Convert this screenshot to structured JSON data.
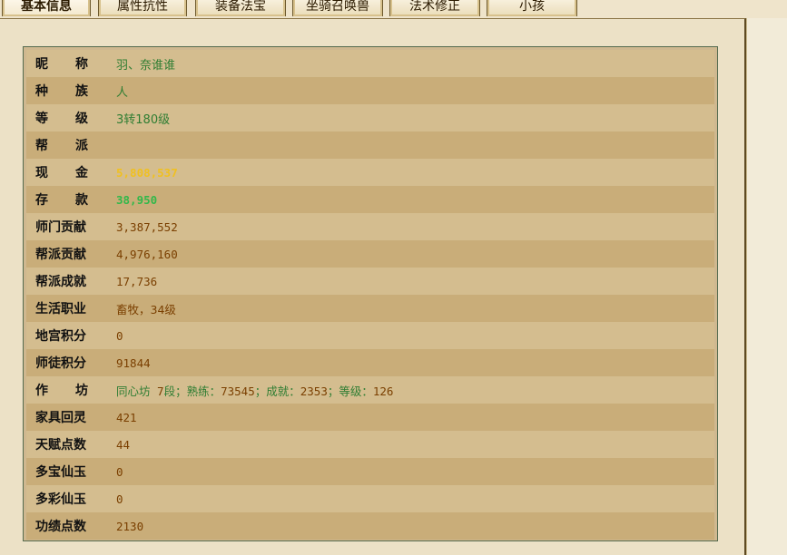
{
  "tabs": [
    {
      "label": "基本信息",
      "active": true
    },
    {
      "label": "属性抗性"
    },
    {
      "label": "装备法宝"
    },
    {
      "label": "坐骑召唤兽"
    },
    {
      "label": "法术修正"
    },
    {
      "label": "小孩"
    }
  ],
  "rows": [
    {
      "label": "昵称",
      "value": "羽、奈谁谁"
    },
    {
      "label": "种族",
      "value": "人"
    },
    {
      "label": "等级",
      "value": "3转180级"
    },
    {
      "label": "帮派",
      "value": ""
    },
    {
      "label": "现金",
      "value": "5,808,537"
    },
    {
      "label": "存款",
      "value": "38,950"
    },
    {
      "label": "师门贡献",
      "value": "3,387,552"
    },
    {
      "label": "帮派贡献",
      "value": "4,976,160"
    },
    {
      "label": "帮派成就",
      "value": "17,736"
    },
    {
      "label": "生活职业",
      "value": "畜牧，34级"
    },
    {
      "label": "地宫积分",
      "value": "0"
    },
    {
      "label": "师徒积分",
      "value": "91844"
    },
    {
      "label": "作坊",
      "value_parts": [
        "同心坊",
        "7",
        "段；熟练：",
        "73545",
        "；成就：",
        "2353",
        "；等级：",
        "126"
      ]
    },
    {
      "label": "家具回灵",
      "value": "421"
    },
    {
      "label": "天赋点数",
      "value": "44"
    },
    {
      "label": "多宝仙玉",
      "value": "0"
    },
    {
      "label": "多彩仙玉",
      "value": "0"
    },
    {
      "label": "功绩点数",
      "value": "2130"
    }
  ],
  "colors": {
    "cash": "#f0c020",
    "deposit": "#32b84a",
    "text_green": "#2e7d32",
    "text_brown": "#7a3f00"
  }
}
